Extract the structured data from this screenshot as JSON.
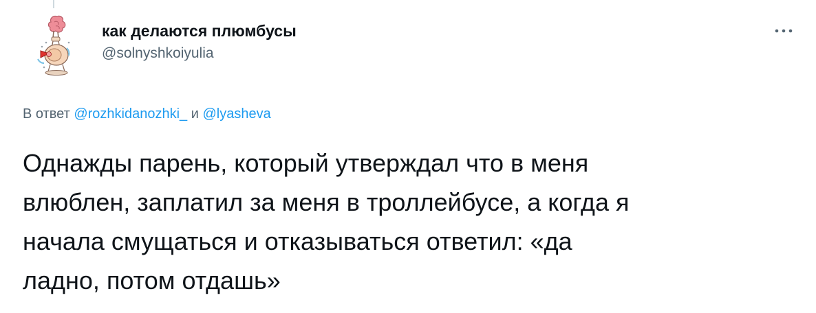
{
  "author": {
    "display_name": "как делаются плюмбусы",
    "handle": "@solnyshkoiyulia"
  },
  "reply": {
    "prefix": "В ответ",
    "mention_1": "@rozhkidanozhki_",
    "conjunction": "и",
    "mention_2": "@lyasheva"
  },
  "tweet": {
    "lines": [
      "Однажды парень, который утверждал что в меня",
      "влюблен, заплатил за меня в троллейбусе, а когда я",
      "начала смущаться и отказываться ответил: «да",
      "ладно, потом отдашь»"
    ]
  },
  "icons": {
    "avatar": "plumbus-avatar",
    "more": "more-dots-icon"
  },
  "colors": {
    "text": "#0f1419",
    "secondary": "#536471",
    "link": "#1d9bf0",
    "background": "#ffffff"
  }
}
